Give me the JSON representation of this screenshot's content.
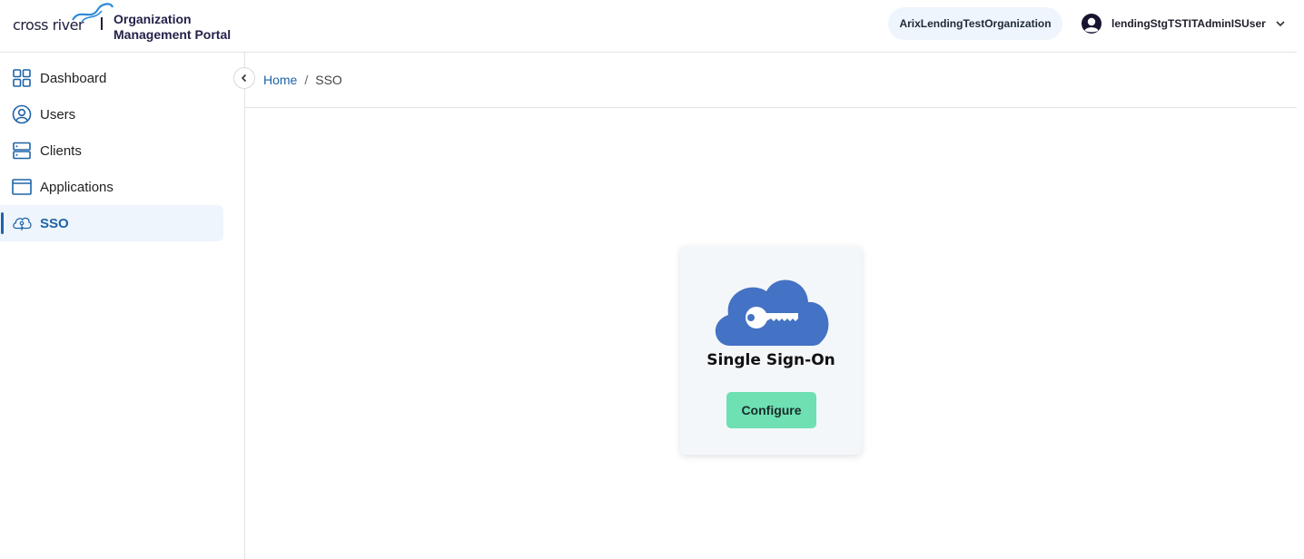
{
  "header": {
    "logo_text": "cross river",
    "portal_title_line1": "Organization",
    "portal_title_line2": "Management Portal",
    "organization_name": "ArixLendingTestOrganization",
    "user_name": "lendingStgTSTITAdminISUser"
  },
  "sidebar": {
    "items": [
      {
        "label": "Dashboard",
        "icon": "dashboard-grid-icon",
        "active": false
      },
      {
        "label": "Users",
        "icon": "user-circle-icon",
        "active": false
      },
      {
        "label": "Clients",
        "icon": "server-icon",
        "active": false
      },
      {
        "label": "Applications",
        "icon": "window-icon",
        "active": false
      },
      {
        "label": "SSO",
        "icon": "cloud-key-icon",
        "active": true
      }
    ]
  },
  "breadcrumb": {
    "home": "Home",
    "separator": "/",
    "current": "SSO"
  },
  "sso_card": {
    "title": "Single Sign-On",
    "button_label": "Configure",
    "graphic_icon": "cloud-key-icon"
  },
  "colors": {
    "accent": "#1e63a8",
    "active_bg": "#eef5fc",
    "button": "#6ee0b2",
    "cloud": "#4472c4"
  }
}
